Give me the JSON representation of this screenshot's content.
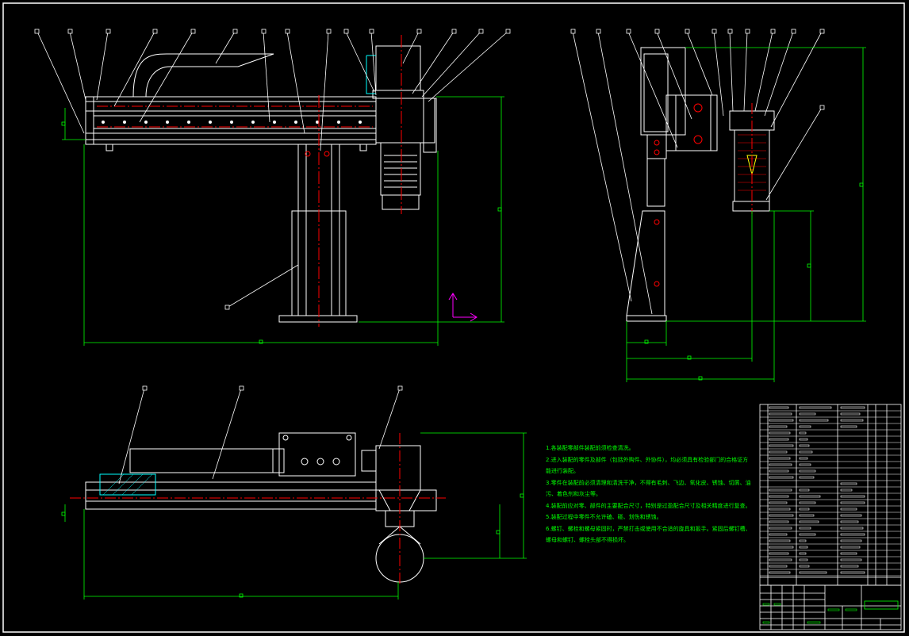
{
  "colors": {
    "background": "#000000",
    "outline": "#ffffff",
    "dimension": "#00ff00",
    "centerline": "#ff0000",
    "accent": "#ff00ff",
    "section_hatch": "#00ffff"
  },
  "technical_notes": {
    "lines": [
      "1.各装配零部件装配前须检查清洗。",
      "2.进入装配的零件及部件（包括外购件、外协件），均必须具有检验部门的合格证方",
      "能进行装配。",
      "3.零件在装配前必须清理和清洗干净，不得有毛刺、飞边、氧化皮、锈蚀、切屑、油",
      "污、着色剂和灰尘等。",
      "4.装配前应对零、部件的主要配合尺寸，特别是过盈配合尺寸及相关精度进行复查。",
      "5.装配过程中零件不允许磕、碰、划伤和锈蚀。",
      "6.螺钉、螺栓和螺母紧固时，严禁打击或使用不合适的旋具和扳手。紧固后螺钉槽、",
      "螺母和螺钉、螺栓头部不得损坏。"
    ]
  },
  "title_block": {
    "drawing_name": ""
  }
}
